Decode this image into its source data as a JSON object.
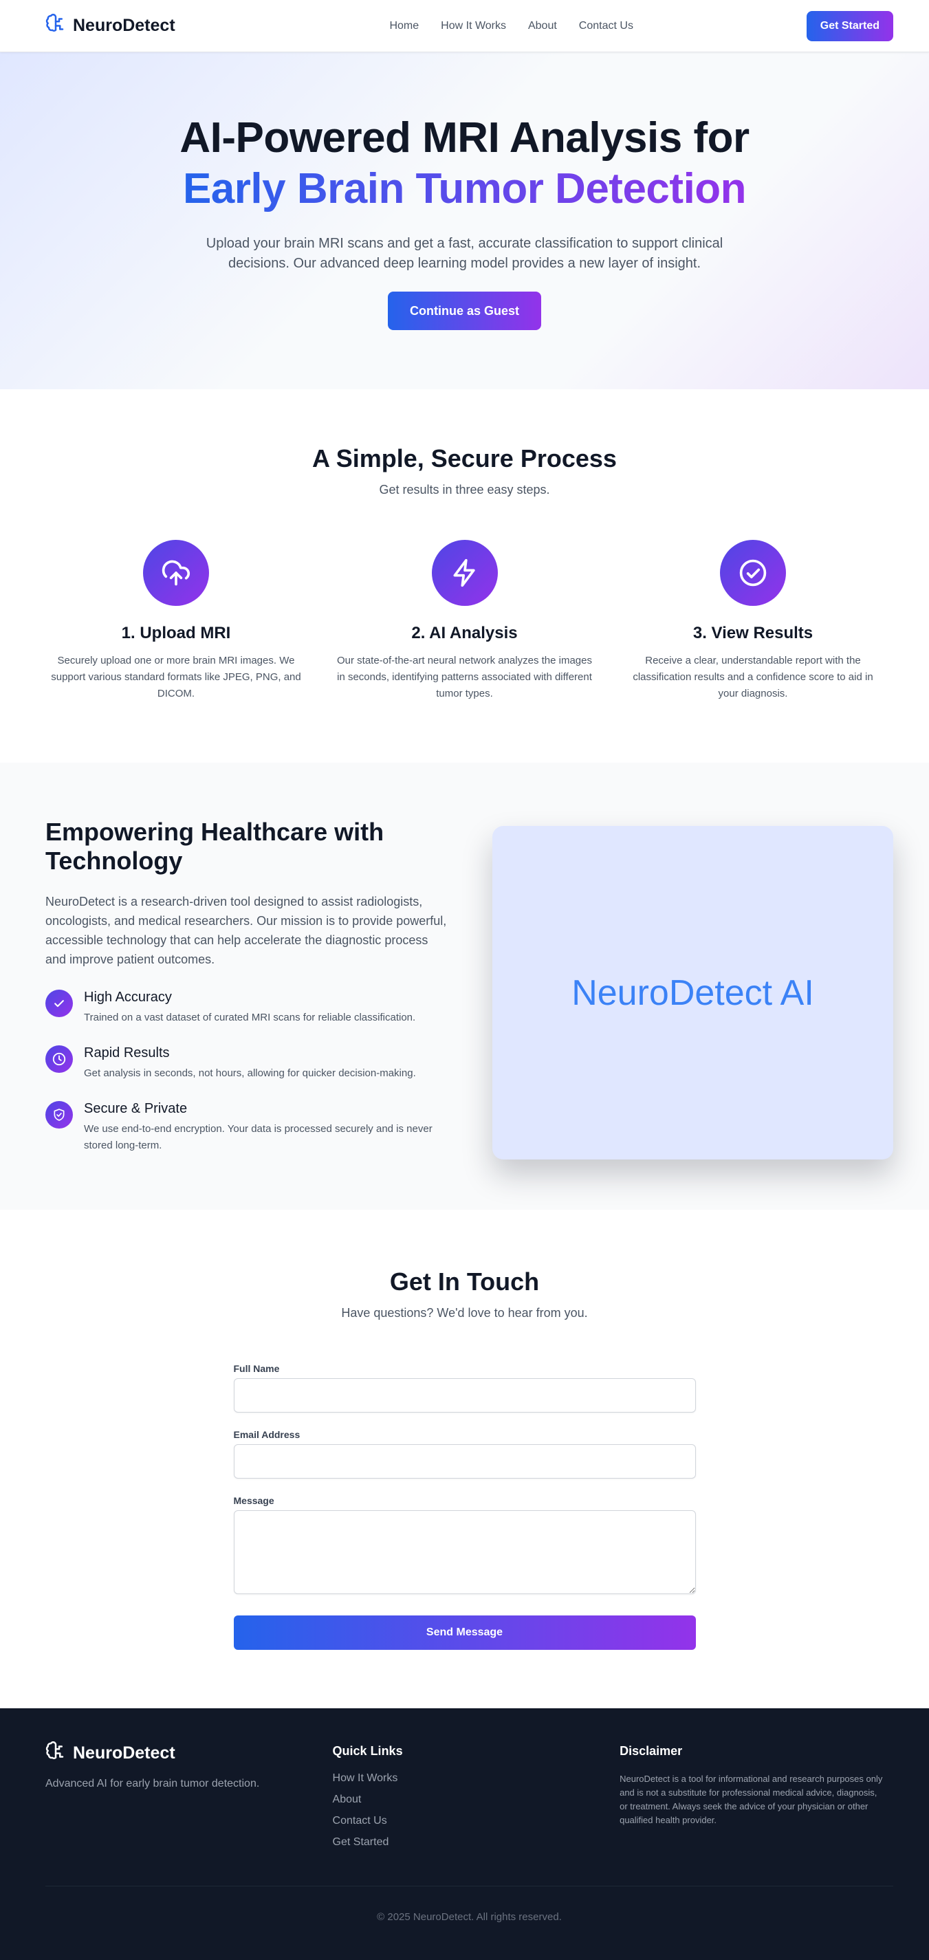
{
  "nav": {
    "brand": "NeuroDetect",
    "brand_icon": "brain-icon",
    "links": [
      "Home",
      "How It Works",
      "About",
      "Contact Us"
    ],
    "cta": "Get Started"
  },
  "hero": {
    "title_line1": "AI-Powered MRI Analysis for",
    "title_line2": "Early Brain Tumor Detection",
    "subtitle": "Upload your brain MRI scans and get a fast, accurate classification to support clinical decisions. Our advanced deep learning model provides a new layer of insight.",
    "cta": "Continue as Guest"
  },
  "process": {
    "title": "A Simple, Secure Process",
    "subtitle": "Get results in three easy steps.",
    "steps": [
      {
        "icon": "cloud-upload-icon",
        "title": "1. Upload MRI",
        "desc": "Securely upload one or more brain MRI images. We support various standard formats like JPEG, PNG, and DICOM."
      },
      {
        "icon": "lightning-icon",
        "title": "2. AI Analysis",
        "desc": "Our state-of-the-art neural network analyzes the images in seconds, identifying patterns associated with different tumor types."
      },
      {
        "icon": "check-circle-icon",
        "title": "3. View Results",
        "desc": "Receive a clear, understandable report with the classification results and a confidence score to aid in your diagnosis."
      }
    ]
  },
  "about": {
    "title": "Empowering Healthcare with Technology",
    "body": "NeuroDetect is a research-driven tool designed to assist radiologists, oncologists, and medical researchers. Our mission is to provide powerful, accessible technology that can help accelerate the diagnostic process and improve patient outcomes.",
    "features": [
      {
        "icon": "check-icon",
        "title": "High Accuracy",
        "desc": "Trained on a vast dataset of curated MRI scans for reliable classification."
      },
      {
        "icon": "clock-icon",
        "title": "Rapid Results",
        "desc": "Get analysis in seconds, not hours, allowing for quicker decision-making."
      },
      {
        "icon": "shield-check-icon",
        "title": "Secure & Private",
        "desc": "We use end-to-end encryption. Your data is processed securely and is never stored long-term."
      }
    ],
    "card_text": "NeuroDetect AI"
  },
  "contact": {
    "title": "Get In Touch",
    "subtitle": "Have questions? We'd love to hear from you.",
    "name_label": "Full Name",
    "name_value": "",
    "email_label": "Email Address",
    "email_value": "",
    "message_label": "Message",
    "message_value": "",
    "submit": "Send Message"
  },
  "footer": {
    "brand": "NeuroDetect",
    "tagline": "Advanced AI for early brain tumor detection.",
    "quick_links_title": "Quick Links",
    "quick_links": [
      "How It Works",
      "About",
      "Contact Us",
      "Get Started"
    ],
    "disclaimer_title": "Disclaimer",
    "disclaimer": "NeuroDetect is a tool for informational and research purposes only and is not a substitute for professional medical advice, diagnosis, or treatment. Always seek the advice of your physician or other qualified health provider.",
    "copyright": "© 2025 NeuroDetect. All rights reserved."
  },
  "colors": {
    "gradient_start": "#2563eb",
    "gradient_end": "#9333ea",
    "dark_bg": "#111827",
    "card_bg": "#e0e7ff",
    "card_text": "#3b82f6"
  }
}
